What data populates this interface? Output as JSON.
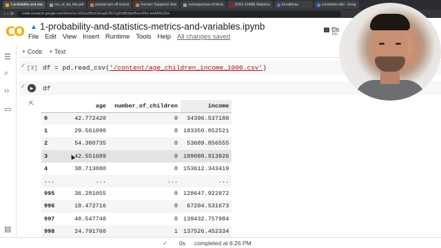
{
  "browser": {
    "tabs": [
      {
        "label": "1-probability-and-stat",
        "active": true
      },
      {
        "label": "cov_of_fat_fats.pdf",
        "active": false
      },
      {
        "label": "pandas turn off scienti",
        "active": false
      },
      {
        "label": "Format / Suppress Scie",
        "active": false
      },
      {
        "label": "consequences of fat-ta",
        "active": false
      },
      {
        "label": "[2001.10488] Statistica",
        "active": false
      },
      {
        "label": "Excalidraw",
        "active": false
      },
      {
        "label": "correlation wiki - Goog",
        "active": false
      }
    ],
    "url": "colab.research.google.com/drive/1cL43Xsa38hcDsFugK2W-Cg2ln8Bo8wHscroFfcn.iwUt5Az2Sm",
    "nav_symbols": "‹ › ⟳"
  },
  "header": {
    "logo_text": "CO",
    "notebook_title": "1-probability-and-statistics-metrics-and-variables.ipynb",
    "star_glyph": "☆",
    "menu": [
      "File",
      "Edit",
      "View",
      "Insert",
      "Runtime",
      "Tools",
      "Help"
    ],
    "save_status": "All changes saved",
    "comment_label": "Co",
    "ram_label": "RA",
    "disk_label": "Dis"
  },
  "toolbar": {
    "add_code": "+ Code",
    "add_text": "+ Text"
  },
  "cells": {
    "cell1": {
      "exec_count": "[3]",
      "code_prefix": "df = pd.read_csv(",
      "code_string": "'/content/age_children_income_1000.csv'",
      "code_suffix": ")"
    },
    "cell2": {
      "code": "df"
    }
  },
  "dataframe": {
    "columns": [
      "age",
      "number_of_children",
      "income"
    ],
    "rows": [
      {
        "index": "0",
        "age": "42.772420",
        "children": "0",
        "income": "34396.537188"
      },
      {
        "index": "1",
        "age": "29.561090",
        "children": "0",
        "income": "183350.052521"
      },
      {
        "index": "2",
        "age": "54.380735",
        "children": "0",
        "income": "53689.856555"
      },
      {
        "index": "3",
        "age": "42.551689",
        "children": "0",
        "income": "109080.913926"
      },
      {
        "index": "4",
        "age": "38.713080",
        "children": "0",
        "income": "153612.343419"
      },
      {
        "index": "...",
        "age": "...",
        "children": "...",
        "income": "..."
      },
      {
        "index": "995",
        "age": "36.281055",
        "children": "0",
        "income": "128647.922872"
      },
      {
        "index": "996",
        "age": "18.472716",
        "children": "0",
        "income": "67204.531673"
      },
      {
        "index": "997",
        "age": "40.547748",
        "children": "0",
        "income": "139432.757984"
      },
      {
        "index": "998",
        "age": "24.791760",
        "children": "1",
        "income": "137526.452334"
      }
    ]
  },
  "status": {
    "time": "0s",
    "completed": "completed at 6:26 PM"
  },
  "colors": {
    "accent_orange": "#f9ab00",
    "success_green": "#34a853"
  }
}
